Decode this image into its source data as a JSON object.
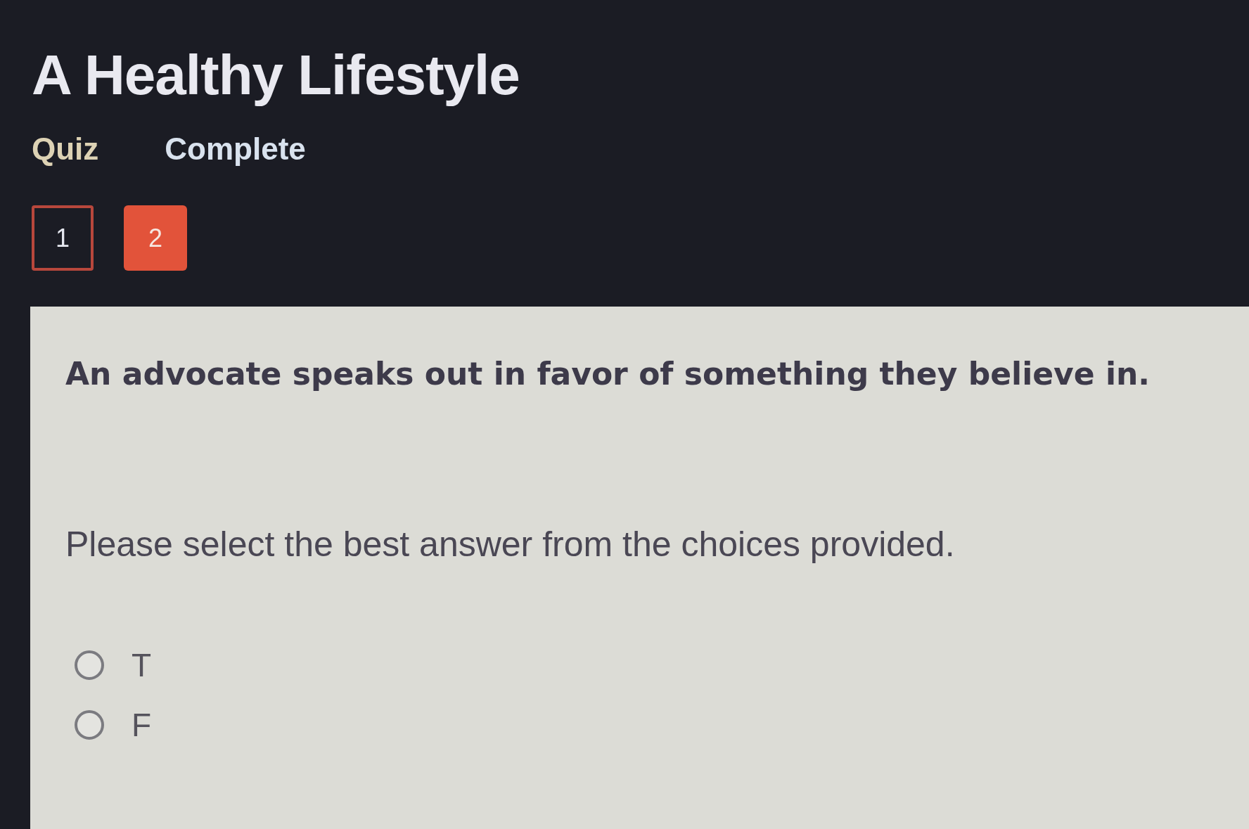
{
  "page": {
    "title": "A Healthy Lifestyle",
    "activity_type": "Quiz",
    "status": "Complete"
  },
  "question_nav": [
    {
      "label": "1",
      "selected": false
    },
    {
      "label": "2",
      "selected": true
    }
  ],
  "question": {
    "prompt": "An advocate speaks out in favor of something they believe in.",
    "instruction": "Please select the best answer from the choices provided.",
    "choices": [
      {
        "label": "T",
        "selected": false
      },
      {
        "label": "F",
        "selected": false
      }
    ]
  }
}
